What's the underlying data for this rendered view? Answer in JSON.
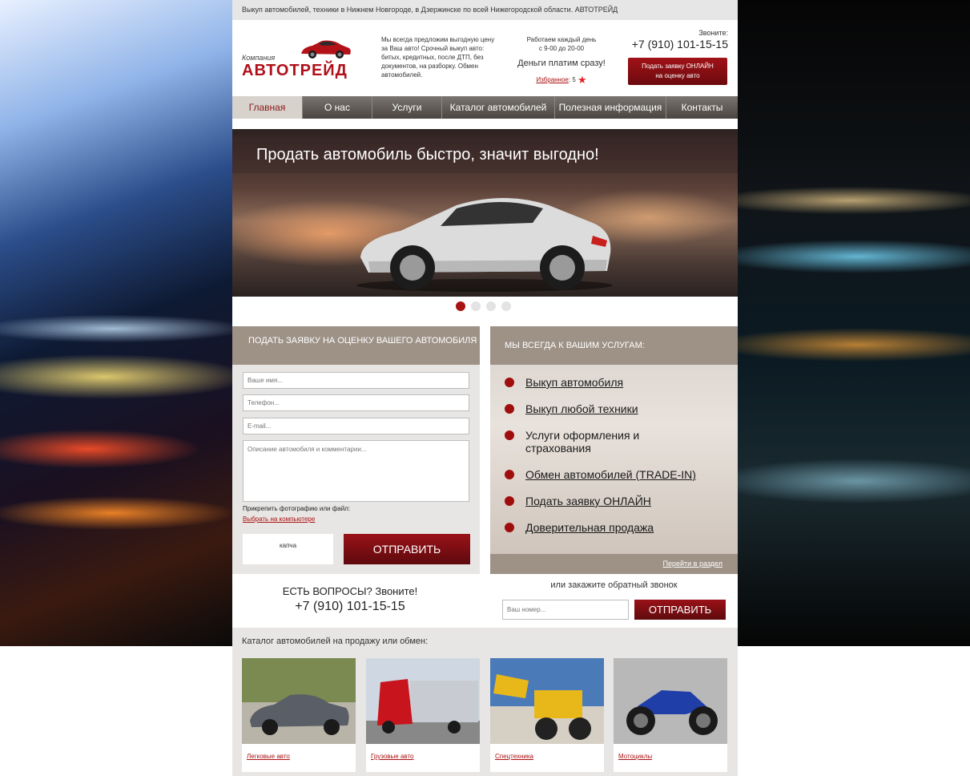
{
  "topbar": {
    "text": "Выкуп автомобилей, техники в Нижнем Новгороде, в Дзержинске по всей Нижегородской области. АВТОТРЕЙД"
  },
  "header": {
    "logo_small": "Компания",
    "logo_big": "АВТОТРЕЙД",
    "promo": "Мы всегда предложим выгодную цену за Ваш авто! Срочный выкуп авто: битых, кредитных, после ДТП, без документов, на разборку. Обмен автомобилей.",
    "hours_line1": "Работаем каждый день",
    "hours_line2": "с 9-00 до 20-00",
    "money": "Деньги платим сразу!",
    "fav_label": "Избранное",
    "fav_count": ": 5",
    "call_label": "Звоните:",
    "phone": "+7 (910) 101-15-15",
    "online_line1": "Подать заявку ОНЛАЙН",
    "online_line2": "на оценку авто"
  },
  "nav": [
    {
      "label": "Главная",
      "active": true
    },
    {
      "label": "О нас"
    },
    {
      "label": "Услуги"
    },
    {
      "label": "Каталог автомобилей"
    },
    {
      "label": "Полезная информация"
    },
    {
      "label": "Контакты"
    }
  ],
  "banner": {
    "title": "Продать автомобиль быстро, значит выгодно!"
  },
  "slider": {
    "count": 4,
    "active_index": 0
  },
  "form": {
    "heading": "ПОДАТЬ ЗАЯВКУ НА ОЦЕНКУ ВАШЕГО АВТОМОБИЛЯ",
    "name_placeholder": "Ваше имя...",
    "phone_placeholder": "Телефон...",
    "email_placeholder": "E-mail...",
    "desc_placeholder": "Описание автомобиля и комментарии...",
    "attach_label": "Прикрепить фотографию или файл:",
    "attach_link": "Выбрать на компьютере",
    "captcha": "капча",
    "submit": "ОТПРАВИТЬ"
  },
  "services": {
    "heading": "МЫ ВСЕГДА К ВАШИМ УСЛУГАМ:",
    "items": [
      "Выкуп автомобиля",
      "Выкуп любой техники",
      "Услуги оформления и страхования",
      "Обмен автомобилей (TRADE-IN)",
      "Подать заявку ОНЛАЙН",
      "Доверительная продажа"
    ],
    "footer_link": "Перейти в раздел"
  },
  "questions": {
    "label": "ЕСТЬ ВОПРОСЫ? Звоните!",
    "phone": "+7 (910) 101-15-15"
  },
  "callback": {
    "label": "или закажите обратный звонок",
    "placeholder": "Ваш номер...",
    "submit": "ОТПРАВИТЬ"
  },
  "catalog": {
    "title": "Каталог автомобилей на продажу или обмен:",
    "items": [
      {
        "label": "Легковые авто"
      },
      {
        "label": "Грузовые авто"
      },
      {
        "label": "Спецтехника"
      },
      {
        "label": "Мотоциклы"
      }
    ]
  },
  "colors": {
    "accent": "#a81414",
    "panel_head": "#9e9287",
    "nav": "#5a5550"
  }
}
